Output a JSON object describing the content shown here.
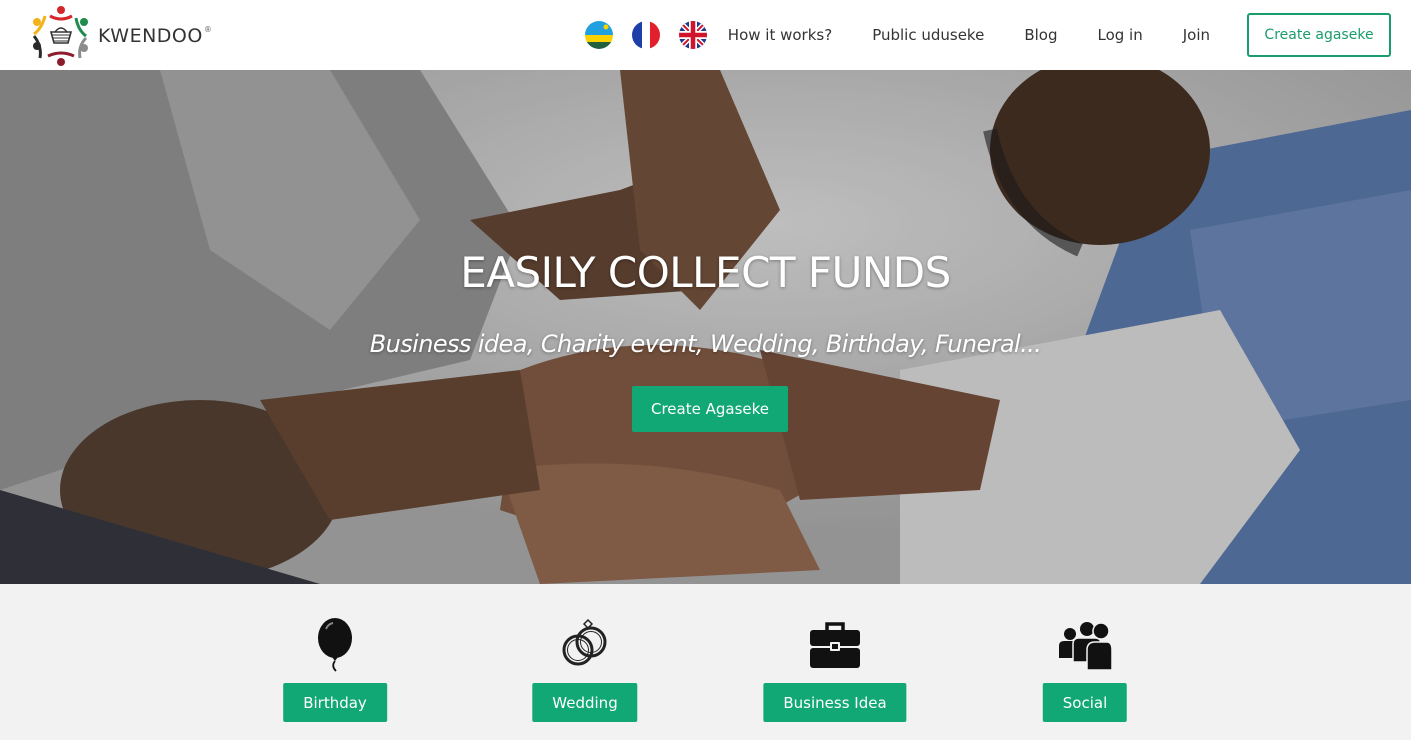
{
  "brand": {
    "name": "KWENDOO",
    "mark": "®"
  },
  "header": {
    "flags": [
      {
        "name": "rwanda-flag-icon",
        "label": "Kinyarwanda"
      },
      {
        "name": "france-flag-icon",
        "label": "Français"
      },
      {
        "name": "uk-flag-icon",
        "label": "English"
      }
    ],
    "nav": {
      "how_it_works": "How it works?",
      "public_uduseke": "Public uduseke",
      "blog": "Blog",
      "log_in": "Log in",
      "join": "Join"
    },
    "cta": "Create agaseke"
  },
  "hero": {
    "title": "EASILY COLLECT FUNDS",
    "subtitle": "Business idea, Charity event, Wedding, Birthday, Funeral...",
    "button": "Create Agaseke"
  },
  "categories": [
    {
      "label": "Birthday",
      "icon": "balloon-icon"
    },
    {
      "label": "Wedding",
      "icon": "rings-icon"
    },
    {
      "label": "Business Idea",
      "icon": "briefcase-icon"
    },
    {
      "label": "Social",
      "icon": "people-icon"
    }
  ],
  "colors": {
    "accent": "#12a876",
    "outline": "#1a9c6c",
    "background": "#f2f2f2"
  }
}
